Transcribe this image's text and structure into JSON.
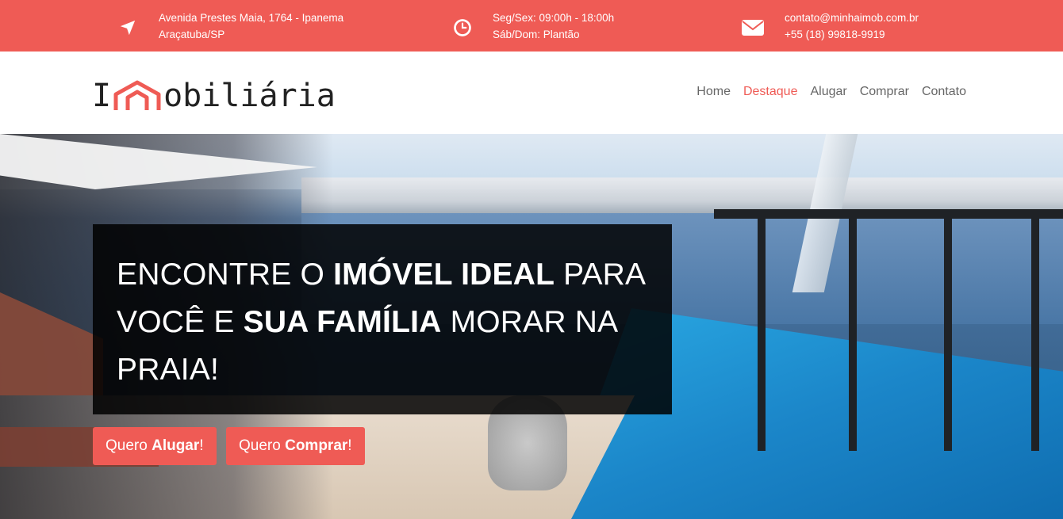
{
  "topbar": {
    "address_line1": "Avenida Prestes Maia, 1764 - Ipanema",
    "address_line2": "Araçatuba/SP",
    "hours_line1": "Seg/Sex: 09:00h - 18:00h",
    "hours_line2": "Sáb/Dom: Plantão",
    "email": "contato@minhaimob.com.br",
    "phone": "+55 (18) 99818-9919",
    "icons": [
      "location-arrow-icon",
      "clock-icon",
      "envelope-icon"
    ]
  },
  "logo": {
    "prefix": "I",
    "suffix": "obiliária",
    "mark": "house-logo-icon"
  },
  "nav": {
    "items": [
      "Home",
      "Destaque",
      "Alugar",
      "Comprar",
      "Contato"
    ],
    "active": "Destaque"
  },
  "hero": {
    "line1_a": "ENCONTRE O ",
    "line1_b": "IMÓVEL IDEAL",
    "line1_c": " PARA",
    "line2_a": "VOCÊ E ",
    "line2_b": "SUA FAMÍLIA",
    "line2_c": " MORAR NA",
    "line3": "PRAIA!",
    "btn_rent_a": "Quero ",
    "btn_rent_b": "Alugar",
    "btn_rent_c": "!",
    "btn_buy_a": "Quero ",
    "btn_buy_b": "Comprar",
    "btn_buy_c": "!"
  },
  "colors": {
    "accent": "#ef5b55",
    "caption_bg": "rgba(0,0,0,0.85)",
    "text_dark": "#222222",
    "nav_text": "#666666"
  }
}
